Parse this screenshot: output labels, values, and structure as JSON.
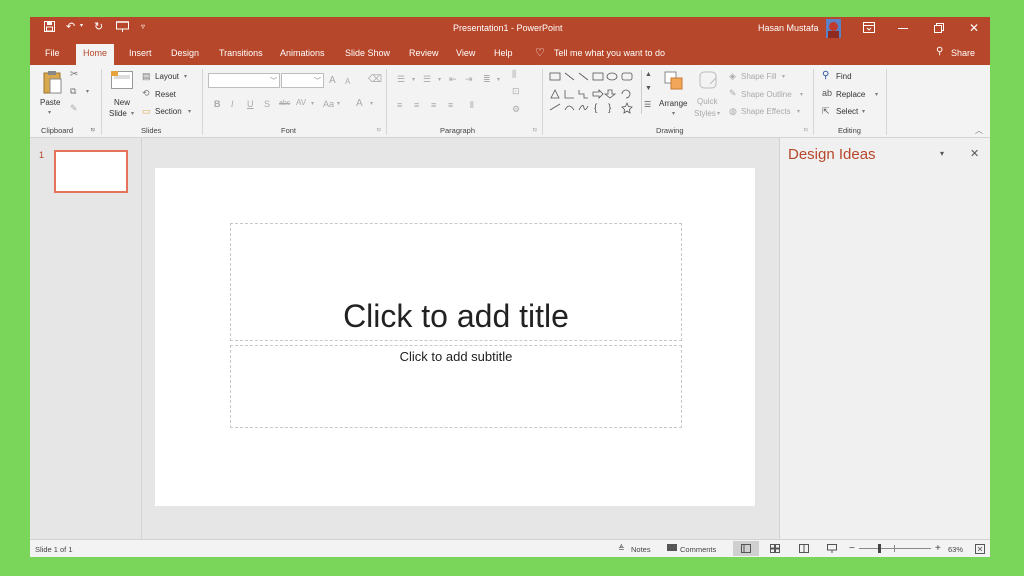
{
  "window": {
    "title": "Presentation1 - PowerPoint",
    "user": "Hasan Mustafa"
  },
  "tabs": [
    "File",
    "Home",
    "Insert",
    "Design",
    "Transitions",
    "Animations",
    "Slide Show",
    "Review",
    "View",
    "Help"
  ],
  "tell_me": "Tell me what you want to do",
  "share": "Share",
  "ribbon": {
    "clipboard": {
      "paste": "Paste",
      "group": "Clipboard"
    },
    "slides": {
      "new_slide_line1": "New",
      "new_slide_line2": "Slide",
      "layout": "Layout",
      "reset": "Reset",
      "section": "Section",
      "group": "Slides"
    },
    "font": {
      "bold": "B",
      "italic": "I",
      "underline": "U",
      "shadow": "S",
      "strike": "abc",
      "spacing": "AV",
      "case": "Aa",
      "color": "A",
      "grow": "A",
      "shrink": "A",
      "group": "Font"
    },
    "paragraph": {
      "group": "Paragraph"
    },
    "drawing": {
      "arrange": "Arrange",
      "quick_styles_1": "Quick",
      "quick_styles_2": "Styles",
      "shape_fill": "Shape Fill",
      "shape_outline": "Shape Outline",
      "shape_effects": "Shape Effects",
      "group": "Drawing"
    },
    "editing": {
      "find": "Find",
      "replace": "Replace",
      "select": "Select",
      "group": "Editing"
    }
  },
  "thumbnail": {
    "number": "1"
  },
  "slide": {
    "title_placeholder": "Click to add title",
    "subtitle_placeholder": "Click to add subtitle"
  },
  "design_ideas": {
    "title": "Design Ideas"
  },
  "status": {
    "slide_count": "Slide 1 of 1",
    "notes": "Notes",
    "comments": "Comments",
    "zoom": "63%",
    "minus": "−",
    "plus": "+"
  },
  "colors": {
    "accent": "#b7472a",
    "background": "#7ad65a"
  }
}
